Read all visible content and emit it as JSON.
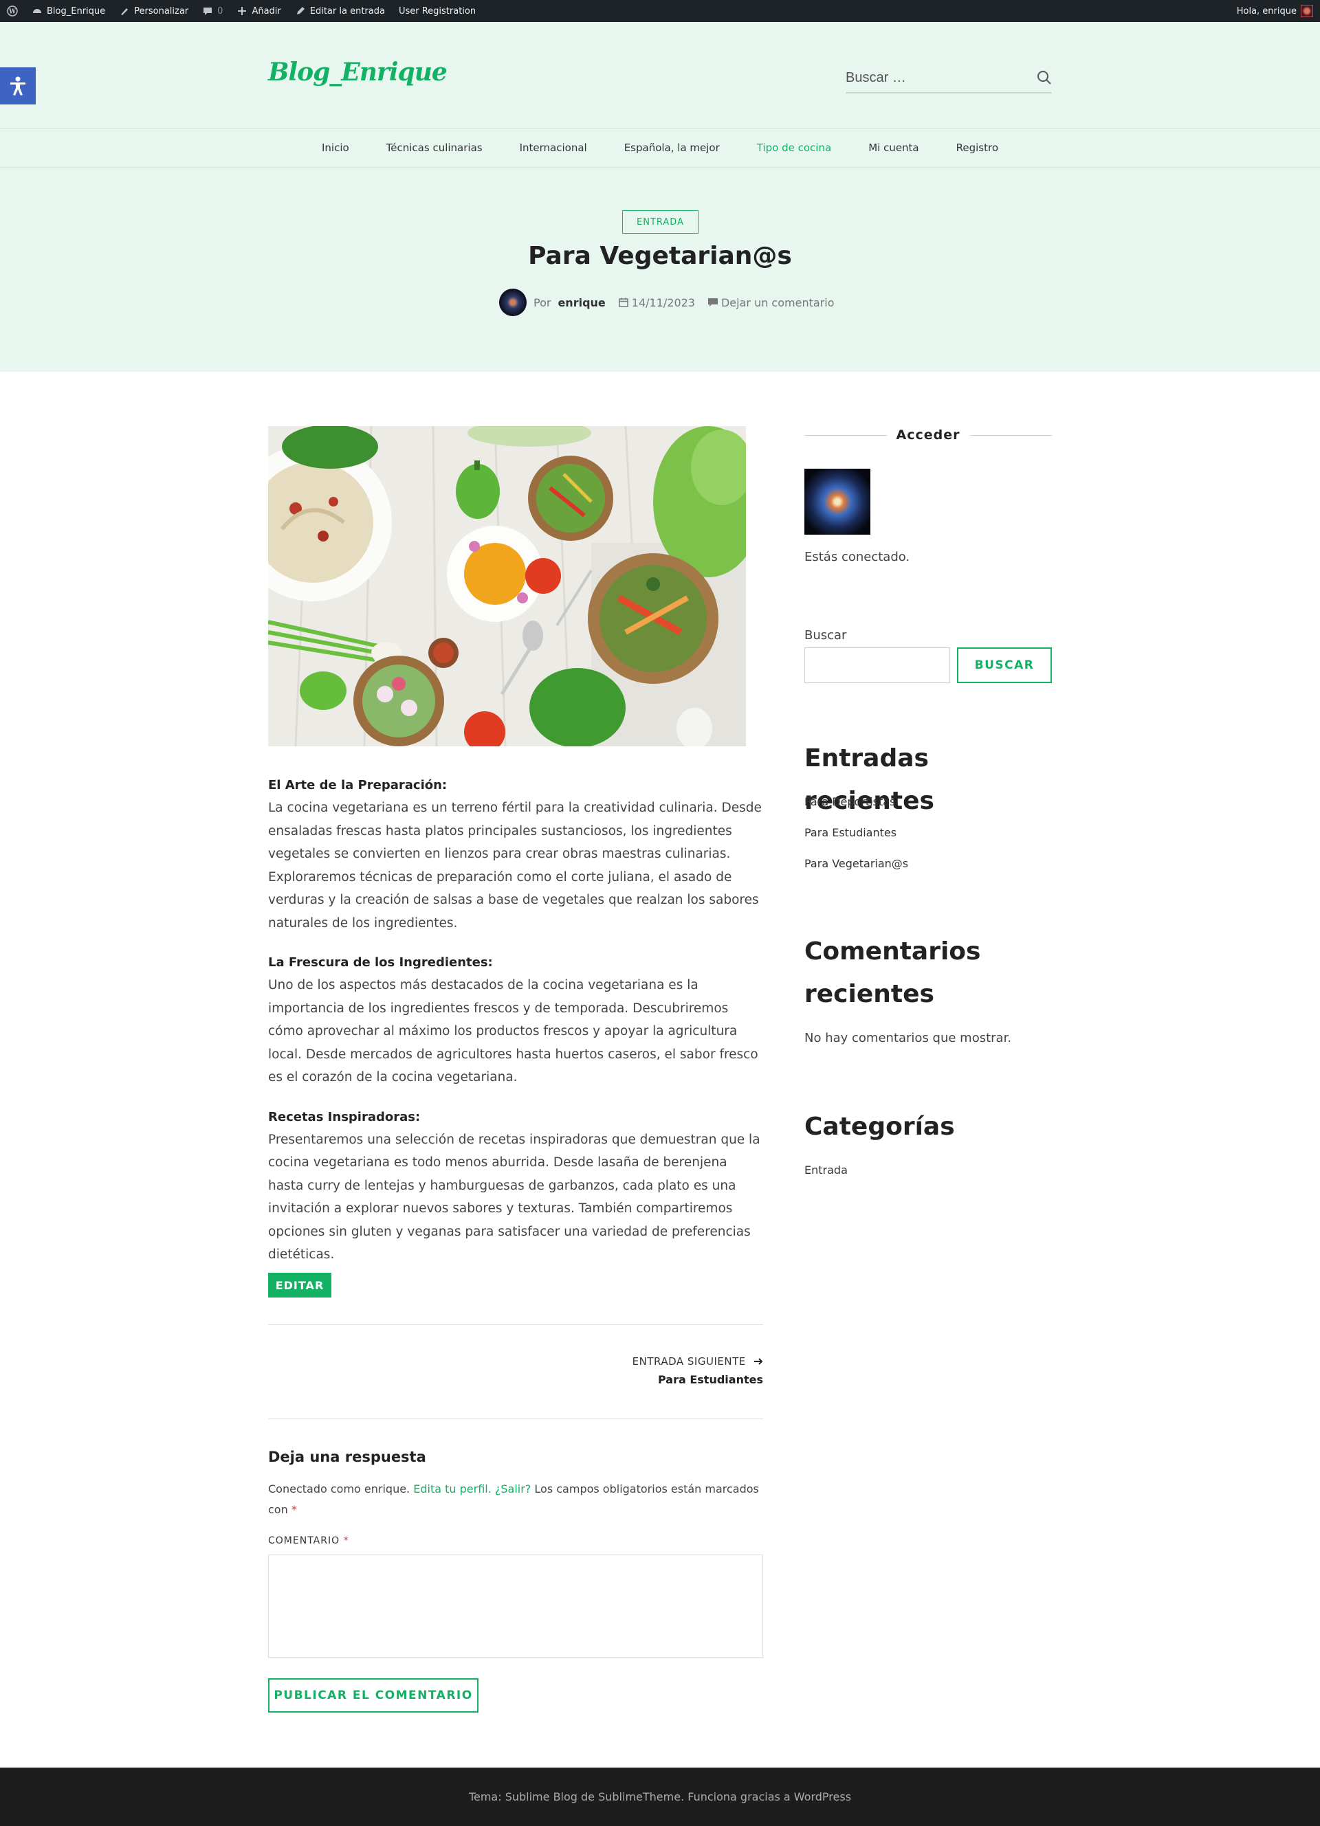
{
  "adminbar": {
    "site_name": "Blog_Enrique",
    "customize": "Personalizar",
    "comments_count": "0",
    "add_new": "Añadir",
    "edit_post": "Editar la entrada",
    "user_registration": "User Registration",
    "greeting": "Hola, enrique"
  },
  "header": {
    "logo": "Blog_Enrique",
    "search_placeholder": "Buscar …"
  },
  "nav": {
    "items": [
      {
        "label": "Inicio"
      },
      {
        "label": "Técnicas culinarias"
      },
      {
        "label": "Internacional"
      },
      {
        "label": "Española, la mejor"
      },
      {
        "label": "Tipo de cocina",
        "active": true
      },
      {
        "label": "Mi cuenta"
      },
      {
        "label": "Registro"
      }
    ]
  },
  "post": {
    "category": "ENTRADA",
    "title": "Para Vegetarian@s",
    "by": "Por",
    "author": "enrique",
    "date": "14/11/2023",
    "comment_link": "Dejar un comentario",
    "sections": [
      {
        "heading": "El Arte de la Preparación:",
        "body": "La cocina vegetariana es un terreno fértil para la creatividad culinaria. Desde ensaladas frescas hasta platos principales sustanciosos, los ingredientes vegetales se convierten en lienzos para crear obras maestras culinarias. Exploraremos técnicas de preparación como el corte juliana, el asado de verduras y la creación de salsas a base de vegetales que realzan los sabores naturales de los ingredientes."
      },
      {
        "heading": "La Frescura de los Ingredientes:",
        "body": "Uno de los aspectos más destacados de la cocina vegetariana es la importancia de los ingredientes frescos y de temporada. Descubriremos cómo aprovechar al máximo los productos frescos y apoyar la agricultura local. Desde mercados de agricultores hasta huertos caseros, el sabor fresco es el corazón de la cocina vegetariana."
      },
      {
        "heading": "Recetas Inspiradoras:",
        "body": "Presentaremos una selección de recetas inspiradoras que demuestran que la cocina vegetariana es todo menos aburrida. Desde lasaña de berenjena hasta curry de lentejas y hamburguesas de garbanzos, cada plato es una invitación a explorar nuevos sabores y texturas. También compartiremos opciones sin gluten y veganas para satisfacer una variedad de preferencias dietéticas."
      }
    ],
    "edit_label": "EDITAR",
    "next_label": "ENTRADA SIGUIENTE",
    "next_title": "Para Estudiantes"
  },
  "comments": {
    "reply_title": "Deja una respuesta",
    "logged_in_prefix": "Conectado como enrique.",
    "edit_profile": "Edita tu perfil.",
    "logout": "¿Salir?",
    "required_note": "Los campos obligatorios están marcados con",
    "required_mark": "*",
    "comment_label": "COMENTARIO",
    "submit_label": "PUBLICAR EL COMENTARIO"
  },
  "sidebar": {
    "login_title": "Acceder",
    "connected": "Estás conectado.",
    "search_label": "Buscar",
    "search_button": "BUSCAR",
    "recent_posts_title": "Entradas recientes",
    "recent_posts": [
      "Para Deportistas",
      "Para Estudiantes",
      "Para Vegetarian@s"
    ],
    "recent_comments_title": "Comentarios recientes",
    "no_comments": "No hay comentarios que mostrar.",
    "categories_title": "Categorías",
    "categories": [
      "Entrada"
    ]
  },
  "footer": {
    "text": "Tema: Sublime Blog de SublimeTheme. Funciona gracias a WordPress"
  },
  "colors": {
    "accent": "#12b164",
    "header_bg": "#e7f7ef",
    "adminbar_bg": "#1d2327",
    "footer_bg": "#1d1d1d",
    "accessibility": "#3d64c3"
  }
}
